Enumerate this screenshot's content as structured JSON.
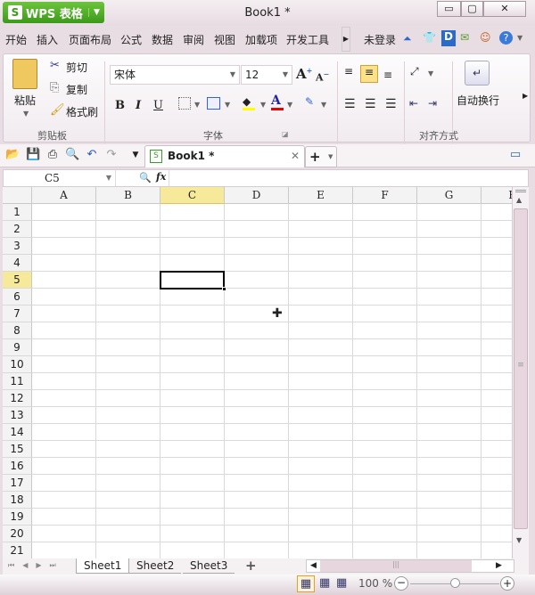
{
  "app": {
    "brand": "WPS 表格",
    "title": "Book1 *"
  },
  "window_controls": {
    "minimize": "▭",
    "restore": "▢",
    "close": "✕"
  },
  "menu": {
    "tabs": [
      "开始",
      "插入",
      "页面布局",
      "公式",
      "数据",
      "审阅",
      "视图",
      "加载项",
      "开发工具"
    ],
    "login": "未登录"
  },
  "ribbon": {
    "clipboard": {
      "paste": "粘贴",
      "cut": "剪切",
      "copy": "复制",
      "format_painter": "格式刷",
      "group": "剪贴板"
    },
    "font": {
      "name": "宋体",
      "size": "12",
      "bold": "B",
      "italic": "I",
      "underline": "U",
      "group": "字体",
      "fill_color": "#ffff00",
      "font_color": "#e00000"
    },
    "align": {
      "wrap": "自动换行",
      "group": "对齐方式"
    }
  },
  "doc_tab": {
    "label": "Book1 *"
  },
  "formula_bar": {
    "name_box": "C5",
    "fx": "fx",
    "value": ""
  },
  "sheet": {
    "columns": [
      "A",
      "B",
      "C",
      "D",
      "E",
      "F",
      "G",
      "H"
    ],
    "rows": [
      "1",
      "2",
      "3",
      "4",
      "5",
      "6",
      "7",
      "8",
      "9",
      "10",
      "11",
      "12",
      "13",
      "14",
      "15",
      "16",
      "17",
      "18",
      "19",
      "20",
      "21"
    ],
    "selected_cell": "C5"
  },
  "sheet_tabs": [
    "Sheet1",
    "Sheet2",
    "Sheet3"
  ],
  "status": {
    "zoom": "100 %"
  }
}
